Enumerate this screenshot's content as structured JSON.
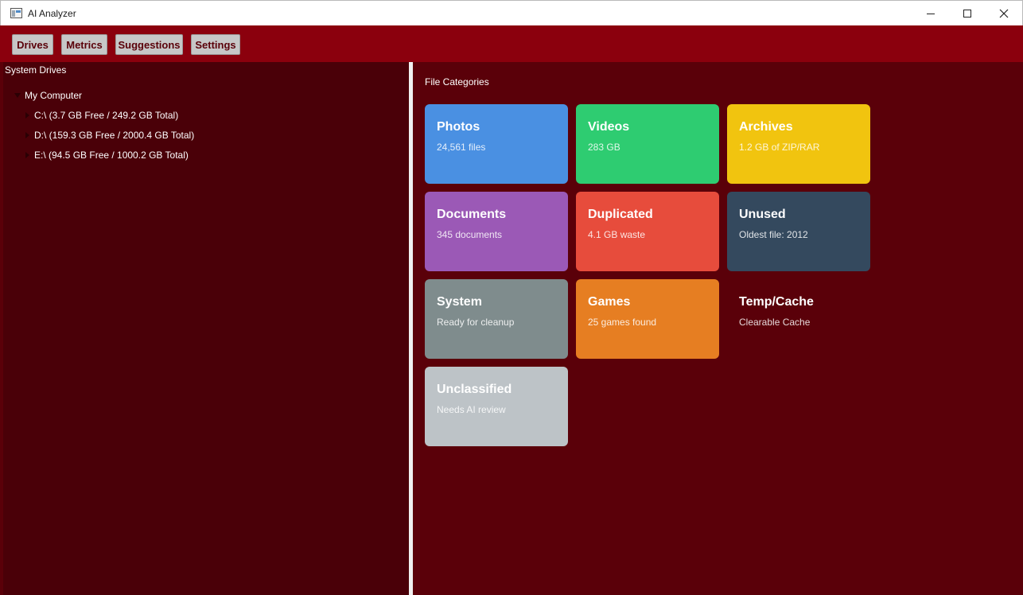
{
  "window": {
    "title": "AI Analyzer"
  },
  "toolbar": {
    "drives": "Drives",
    "metrics": "Metrics",
    "suggestions": "Suggestions",
    "settings": "Settings"
  },
  "drives_pane": {
    "title": "System Drives",
    "root": "My Computer",
    "drives": [
      "C:\\ (3.7 GB Free / 249.2 GB Total)",
      "D:\\ (159.3 GB Free / 2000.4 GB Total)",
      "E:\\ (94.5 GB Free / 1000.2 GB Total)"
    ]
  },
  "categories_pane": {
    "title": "File Categories",
    "cards": [
      {
        "name": "Photos",
        "detail": "24,561 files",
        "color": "#4a90e2"
      },
      {
        "name": "Videos",
        "detail": "283 GB",
        "color": "#2ecc71"
      },
      {
        "name": "Archives",
        "detail": "1.2 GB of ZIP/RAR",
        "color": "#f1c40f"
      },
      {
        "name": "Documents",
        "detail": "345 documents",
        "color": "#9b59b6"
      },
      {
        "name": "Duplicated",
        "detail": "4.1 GB waste",
        "color": "#e74c3c"
      },
      {
        "name": "Unused",
        "detail": "Oldest file: 2012",
        "color": "#34495e"
      },
      {
        "name": "System",
        "detail": "Ready for cleanup",
        "color": "#7f8c8d"
      },
      {
        "name": "Games",
        "detail": "25 games found",
        "color": "#e67e22"
      },
      {
        "name": "Temp/Cache",
        "detail": "Clearable Cache",
        "color": "#5a0009"
      },
      {
        "name": "Unclassified",
        "detail": "Needs AI review",
        "color": "#bdc3c7"
      }
    ]
  }
}
